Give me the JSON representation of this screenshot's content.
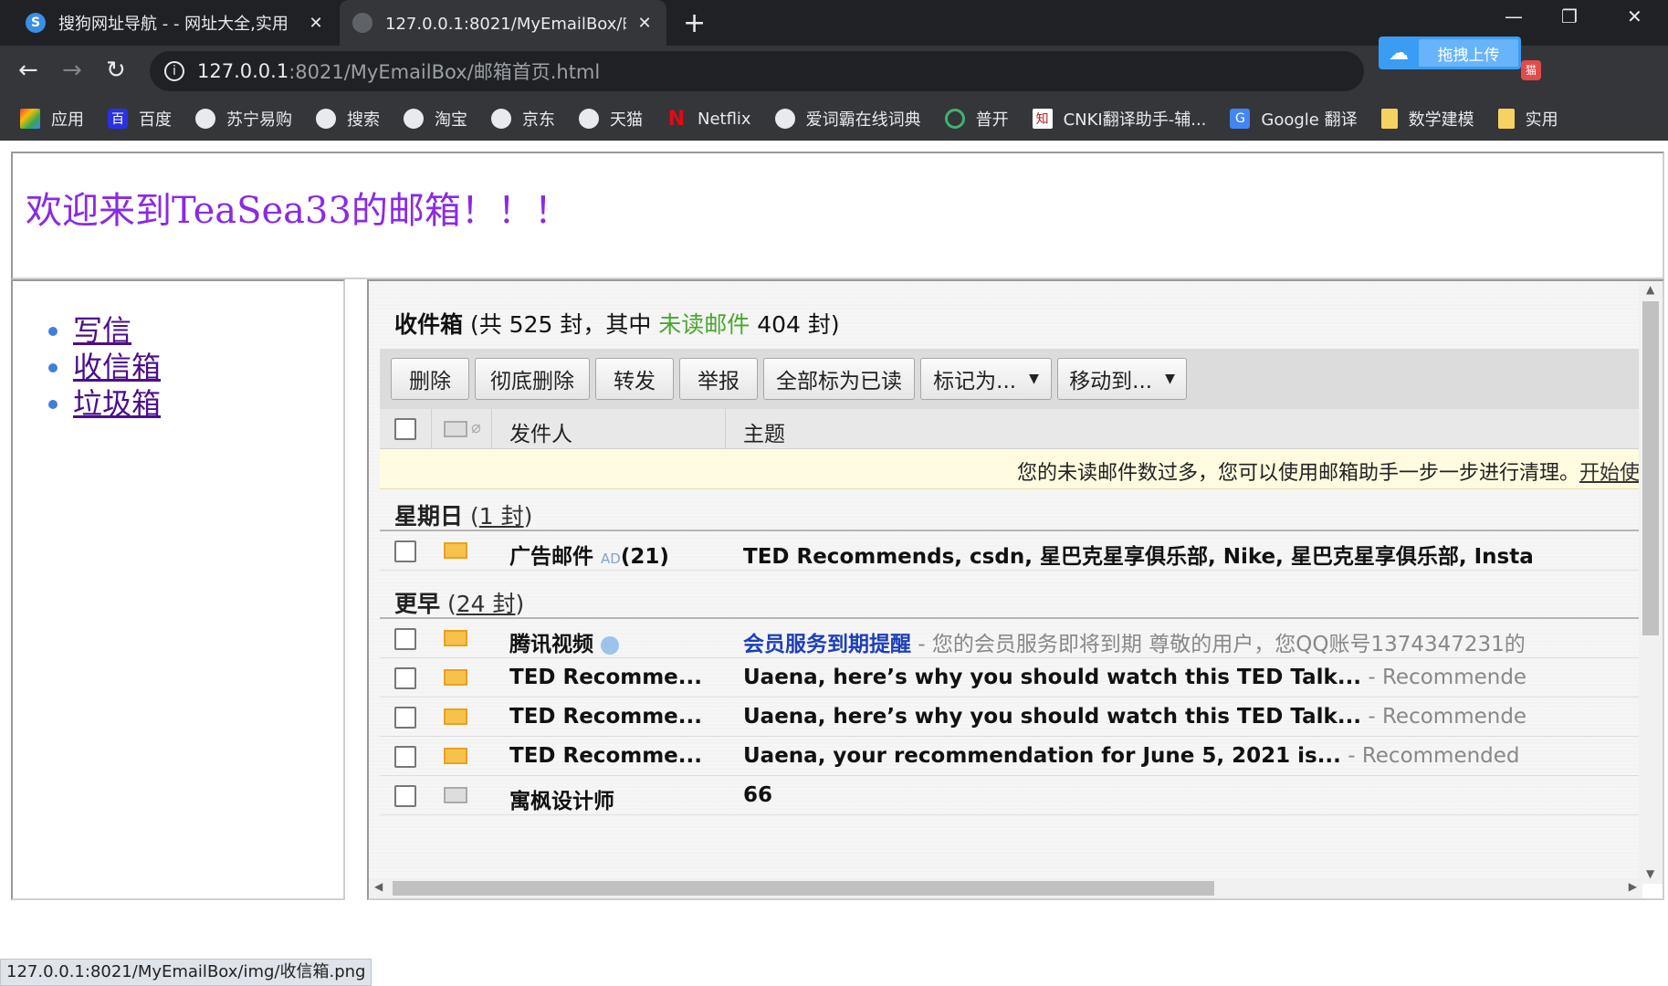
{
  "browser": {
    "tabs": [
      {
        "title": "搜狗网址导航 - - 网址大全,实用"
      },
      {
        "title": "127.0.0.1:8021/MyEmailBox/邮"
      }
    ],
    "url_host": "127.0.0.1",
    "url_path": ":8021/MyEmailBox/邮箱首页.html",
    "upload_label": "拖拽上传",
    "bookmarks": [
      {
        "label": "应用",
        "icon": "apps-grid-icon"
      },
      {
        "label": "百度",
        "icon": "baidu-icon"
      },
      {
        "label": "苏宁易购",
        "icon": "globe-icon"
      },
      {
        "label": "搜索",
        "icon": "globe-icon"
      },
      {
        "label": "淘宝",
        "icon": "globe-icon"
      },
      {
        "label": "京东",
        "icon": "globe-icon"
      },
      {
        "label": "天猫",
        "icon": "globe-icon"
      },
      {
        "label": "Netflix",
        "icon": "netflix-icon"
      },
      {
        "label": "爱词霸在线词典",
        "icon": "globe-icon"
      },
      {
        "label": "普开",
        "icon": "puke-icon"
      },
      {
        "label": "CNKI翻译助手-辅...",
        "icon": "cnki-icon"
      },
      {
        "label": "Google 翻译",
        "icon": "google-translate-icon"
      },
      {
        "label": "数学建模",
        "icon": "folder-icon"
      },
      {
        "label": "实用",
        "icon": "folder-icon"
      }
    ]
  },
  "page": {
    "welcome": "欢迎来到TeaSea33的邮箱！！！",
    "nav": [
      "写信",
      "收信箱",
      "垃圾箱"
    ]
  },
  "mail": {
    "inbox_label": "收件箱",
    "count_prefix": " (共 525 封，其中 ",
    "unread_label": "未读邮件",
    "count_suffix": " 404 封)",
    "buttons": [
      "删除",
      "彻底删除",
      "转发",
      "举报",
      "全部标为已读",
      "标记为...",
      "移动到..."
    ],
    "col_sender": "发件人",
    "col_subject": "主题",
    "notice_text": "您的未读邮件数过多，您可以使用邮箱助手一步一步进行清理。",
    "notice_link": "开始使",
    "group1": {
      "name": "星期日",
      "count": "1 封"
    },
    "group2": {
      "name": "更早",
      "count": "24 封"
    },
    "ad_row": {
      "sender": "广告邮件",
      "ad": "AD",
      "count": "(21)",
      "subject": "TED Recommends, csdn, 星巴克星享俱乐部, Nike, 星巴克星享俱乐部, Insta"
    },
    "rows": [
      {
        "sender": "腾讯视频",
        "subject_blue": "会员服务到期提醒",
        "snippet": " -  您的会员服务即将到期 尊敬的用户，您QQ账号1374347231的"
      },
      {
        "sender": "TED Recomme...",
        "subject": "Uaena, here’s why you should watch this TED Talk...",
        "snippet": " - Recommende"
      },
      {
        "sender": "TED Recomme...",
        "subject": "Uaena, here’s why you should watch this TED Talk...",
        "snippet": " - Recommende"
      },
      {
        "sender": "TED Recomme...",
        "subject": "Uaena, your recommendation for June 5, 2021 is...",
        "snippet": " - Recommended"
      },
      {
        "sender": "寓枫设计师",
        "subject": "66",
        "snippet": ""
      }
    ]
  },
  "status_bar": "127.0.0.1:8021/MyEmailBox/img/收信箱.png"
}
